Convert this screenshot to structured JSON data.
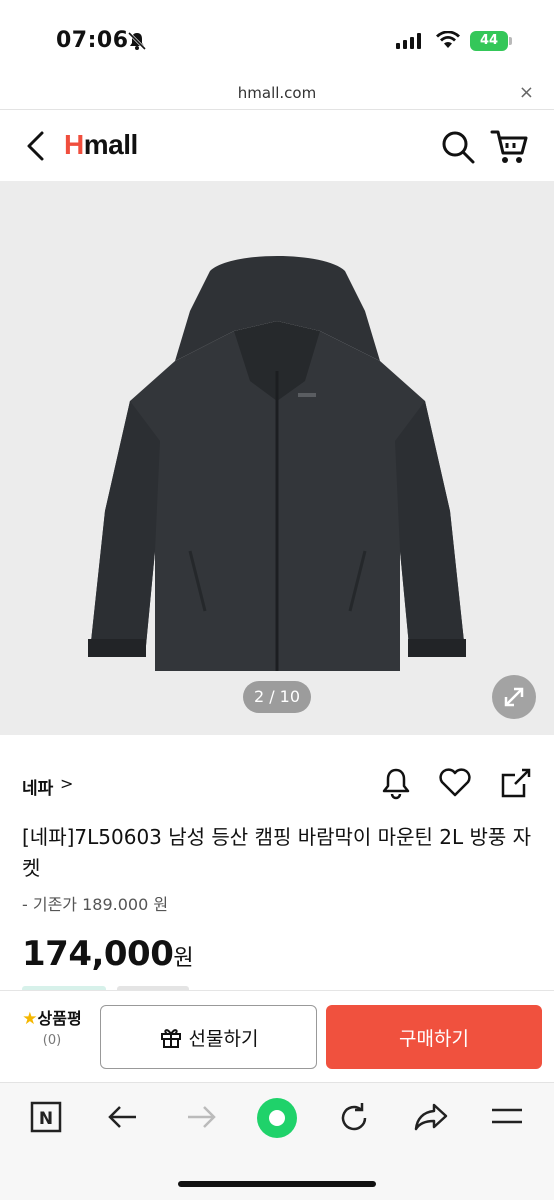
{
  "status_bar": {
    "time": "07:06",
    "battery": "44"
  },
  "browser": {
    "url": "hmall.com",
    "close_label": "×"
  },
  "header": {
    "logo_h": "H",
    "logo_rest": "mall"
  },
  "gallery": {
    "counter": "2 / 10"
  },
  "product": {
    "brand": "네파",
    "brand_chevron": ">",
    "title": "[네파]7L50603 남성 등산 캠핑 바람막이 마운틴 2L 방풍 자켓",
    "original_price": "- 기존가 189.000 원",
    "price": "174,000",
    "price_unit": "원"
  },
  "actions": {
    "review_label": "상품평",
    "review_count": "(0)",
    "gift_label": "선물하기",
    "buy_label": "구매하기"
  },
  "toolbar": {
    "n_label": "N"
  },
  "colors": {
    "accent": "#f0513e",
    "logo_red": "#f04e3d",
    "record_green": "#1fd26a"
  },
  "icons": [
    "bell-slash-icon",
    "signal-icon",
    "wifi-icon",
    "back-icon",
    "search-icon",
    "cart-icon",
    "expand-icon",
    "bell-icon",
    "heart-icon",
    "share-icon",
    "star-icon",
    "gift-icon",
    "n-icon",
    "arrow-left-icon",
    "arrow-right-icon",
    "record-icon",
    "reload-icon",
    "forward-share-icon",
    "menu-icon"
  ]
}
